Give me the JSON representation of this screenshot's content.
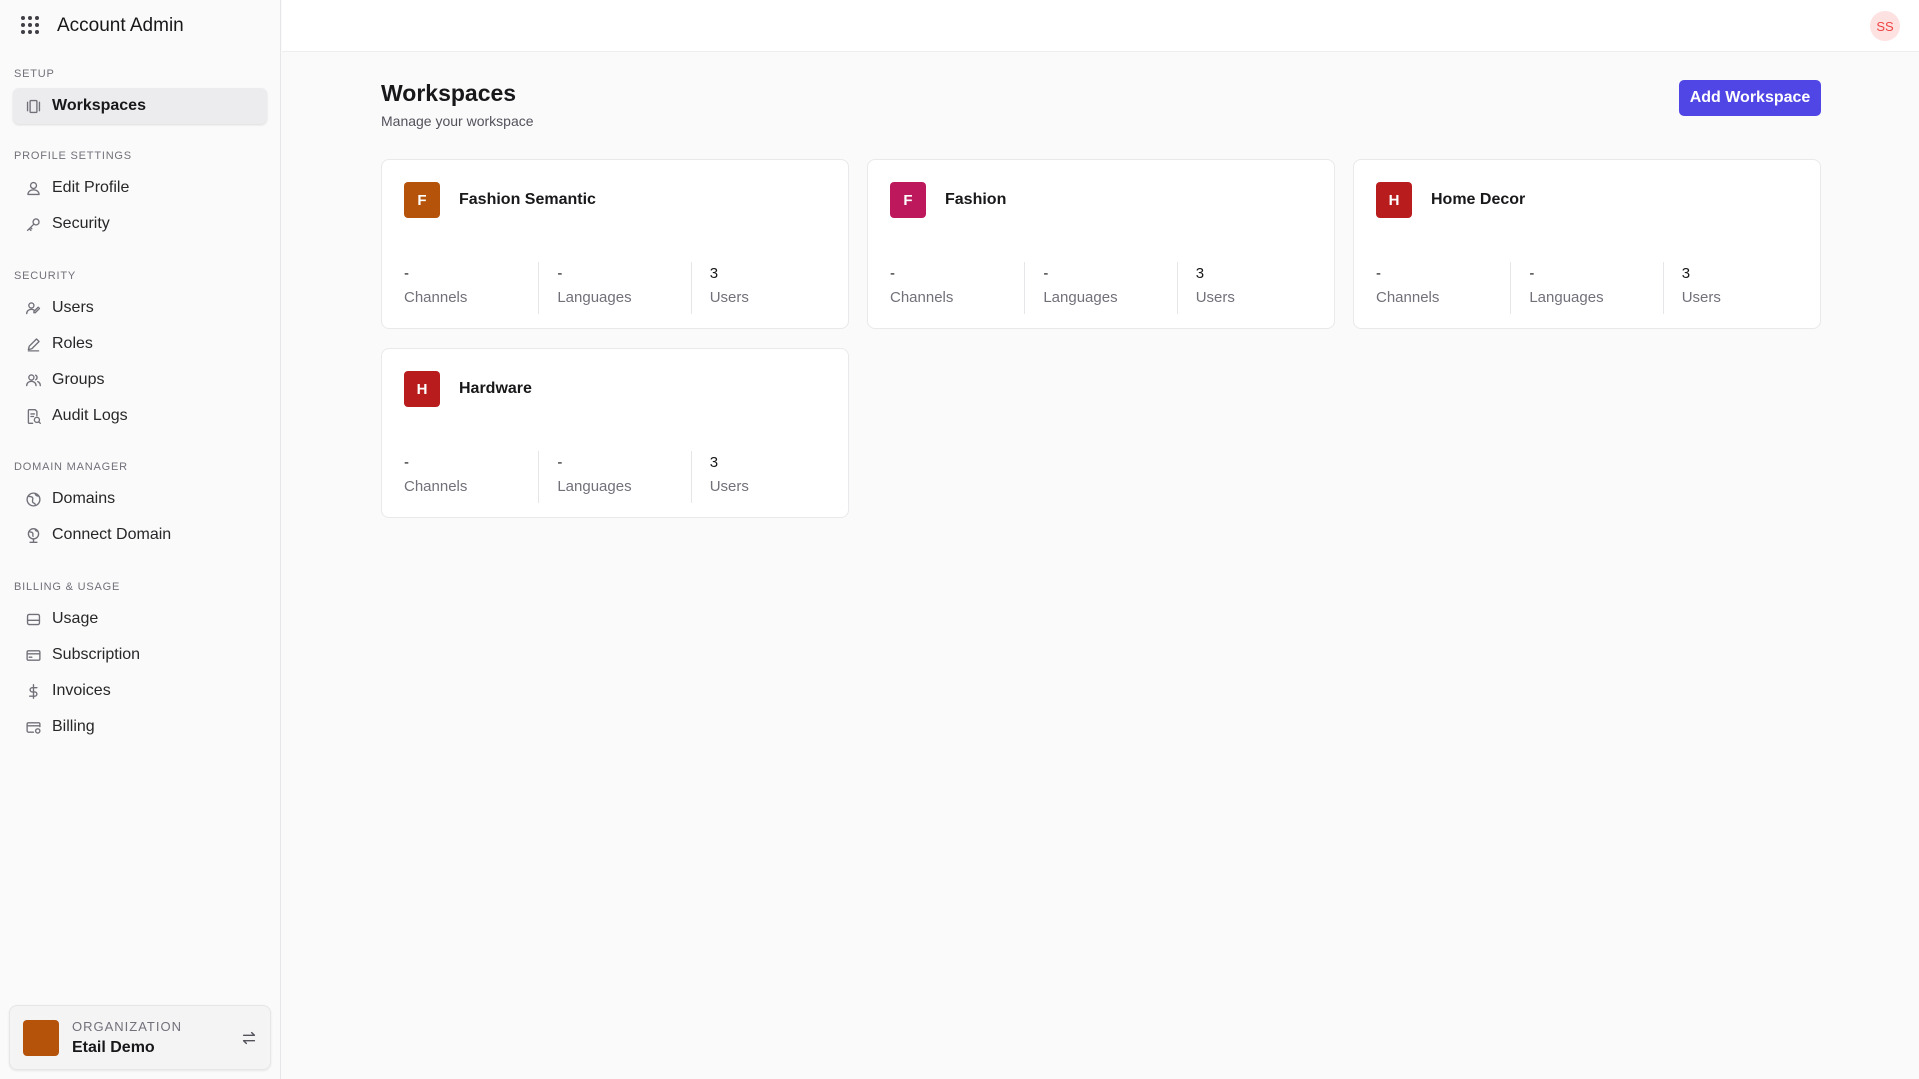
{
  "app": {
    "title": "Account Admin"
  },
  "sidebar": {
    "sections": [
      {
        "label": "SETUP",
        "items": [
          {
            "label": "Workspaces",
            "icon": "workspaces-icon",
            "active": true
          }
        ]
      },
      {
        "label": "PROFILE SETTINGS",
        "items": [
          {
            "label": "Edit Profile",
            "icon": "user-icon"
          },
          {
            "label": "Security",
            "icon": "key-icon"
          }
        ]
      },
      {
        "label": "SECURITY",
        "items": [
          {
            "label": "Users",
            "icon": "users-icon"
          },
          {
            "label": "Roles",
            "icon": "pencil-icon"
          },
          {
            "label": "Groups",
            "icon": "group-icon"
          },
          {
            "label": "Audit Logs",
            "icon": "audit-log-icon"
          }
        ]
      },
      {
        "label": "DOMAIN MANAGER",
        "items": [
          {
            "label": "Domains",
            "icon": "globe-icon"
          },
          {
            "label": "Connect Domain",
            "icon": "globe-connect-icon"
          }
        ]
      },
      {
        "label": "BILLING & USAGE",
        "items": [
          {
            "label": "Usage",
            "icon": "usage-icon"
          },
          {
            "label": "Subscription",
            "icon": "card-icon"
          },
          {
            "label": "Invoices",
            "icon": "dollar-icon"
          },
          {
            "label": "Billing",
            "icon": "billing-icon"
          }
        ]
      }
    ],
    "organization": {
      "label": "ORGANIZATION",
      "name": "Etail Demo",
      "color": "#b45309"
    }
  },
  "header": {
    "avatar_initials": "SS"
  },
  "main": {
    "title": "Workspaces",
    "subtitle": "Manage your workspace",
    "add_button_label": "Add Workspace",
    "workspaces": [
      {
        "initial": "F",
        "name": "Fashion Semantic",
        "color": "#b45309",
        "channels": "-",
        "languages": "-",
        "users": "3"
      },
      {
        "initial": "F",
        "name": "Fashion",
        "color": "#be185d",
        "channels": "-",
        "languages": "-",
        "users": "3"
      },
      {
        "initial": "H",
        "name": "Home Decor",
        "color": "#b91c1c",
        "channels": "-",
        "languages": "-",
        "users": "3"
      },
      {
        "initial": "H",
        "name": "Hardware",
        "color": "#b91c1c",
        "channels": "-",
        "languages": "-",
        "users": "3"
      }
    ],
    "stat_labels": {
      "channels": "Channels",
      "languages": "Languages",
      "users": "Users"
    }
  }
}
